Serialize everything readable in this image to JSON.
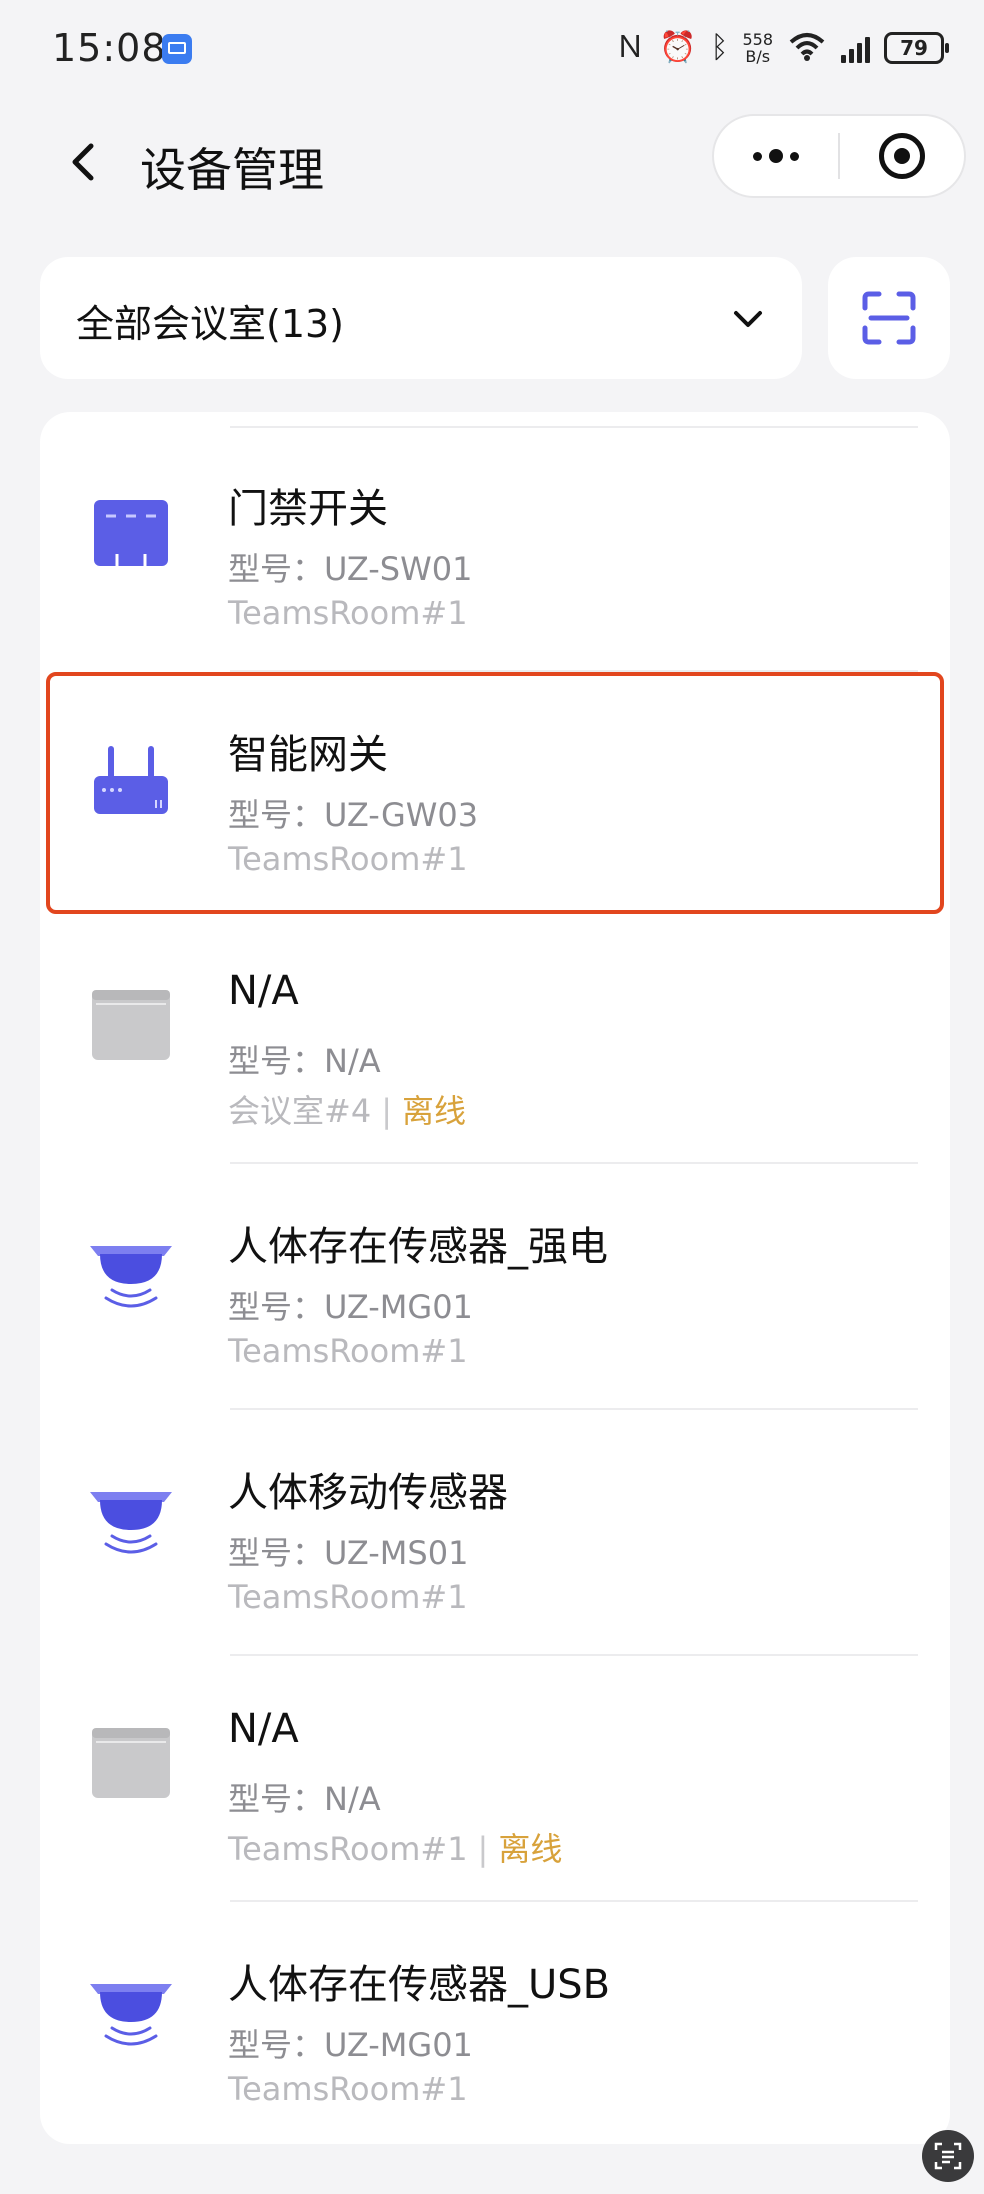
{
  "status_bar": {
    "time": "15:08",
    "net_speed_value": "558",
    "net_speed_unit": "B/s",
    "battery": "79"
  },
  "header": {
    "title": "设备管理",
    "back_icon": "chevron-left-icon",
    "more_icon": "more-dots-icon",
    "close_icon": "target-circle-icon"
  },
  "filter": {
    "room_select_label": "全部会议室(13)",
    "scan_icon": "scan-icon"
  },
  "colors": {
    "accent": "#5b5ee6",
    "offline": "#d8a23b",
    "highlight_border": "#e2461e",
    "background": "#f4f4f6"
  },
  "devices": [
    {
      "name": "门禁开关",
      "model_label": "型号：",
      "model": "UZ-SW01",
      "room": "TeamsRoom#1",
      "status": "",
      "icon": "switch-icon"
    },
    {
      "name": "智能网关",
      "model_label": "型号：",
      "model": "UZ-GW03",
      "room": "TeamsRoom#1",
      "status": "",
      "icon": "router-icon"
    },
    {
      "name": "N/A",
      "model_label": "型号：",
      "model": "N/A",
      "room": "会议室#4",
      "status": "离线",
      "icon": "generic-device-icon"
    },
    {
      "name": "人体存在传感器_强电",
      "model_label": "型号：",
      "model": "UZ-MG01",
      "room": "TeamsRoom#1",
      "status": "",
      "icon": "sensor-icon"
    },
    {
      "name": "人体移动传感器",
      "model_label": "型号：",
      "model": "UZ-MS01",
      "room": "TeamsRoom#1",
      "status": "",
      "icon": "sensor-icon"
    },
    {
      "name": "N/A",
      "model_label": "型号：",
      "model": "N/A",
      "room": "TeamsRoom#1",
      "status": "离线",
      "icon": "generic-device-icon"
    },
    {
      "name": "人体存在传感器_USB",
      "model_label": "型号：",
      "model": "UZ-MG01",
      "room": "TeamsRoom#1",
      "status": "",
      "icon": "sensor-icon"
    }
  ]
}
